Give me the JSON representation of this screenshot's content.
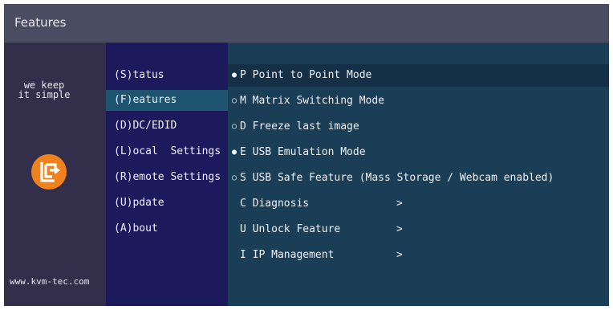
{
  "window": {
    "title": "Features"
  },
  "sidebar": {
    "tagline_line1": "we keep",
    "tagline_line2": "it simple",
    "logo": "kvm-tec-logo",
    "url": "www.kvm-tec.com"
  },
  "menu": {
    "items": [
      {
        "label": "(S)tatus"
      },
      {
        "label": "(F)eatures",
        "selected": true
      },
      {
        "label": "(D)DC/EDID"
      },
      {
        "label": "(L)ocal  Settings"
      },
      {
        "label": "(R)emote Settings"
      },
      {
        "label": "(U)pdate"
      },
      {
        "label": "(A)bout"
      }
    ]
  },
  "features": {
    "rows": [
      {
        "bullet": "●",
        "label": "P Point to Point Mode",
        "chevron": "",
        "highlighted": true
      },
      {
        "bullet": "○",
        "label": "M Matrix Switching Mode",
        "chevron": ""
      },
      {
        "bullet": "○",
        "label": "D Freeze last image",
        "chevron": ""
      },
      {
        "bullet": "●",
        "label": "E USB Emulation Mode",
        "chevron": ""
      },
      {
        "bullet": "○",
        "label": "S USB Safe Feature (Mass Storage / Webcam enabled)",
        "chevron": ""
      },
      {
        "bullet": "",
        "label": "C Diagnosis",
        "chevron": ">"
      },
      {
        "bullet": "",
        "label": "U Unlock Feature",
        "chevron": ">"
      },
      {
        "bullet": "",
        "label": "I IP Management",
        "chevron": ">"
      }
    ]
  },
  "colors": {
    "brand_orange": "#f0821e",
    "title_bar": "#4a4c62",
    "menu_bg": "#1c1a5c",
    "menu_selected": "#1d5470",
    "content_bg": "#1b3e57",
    "content_highlight": "#142f46"
  }
}
